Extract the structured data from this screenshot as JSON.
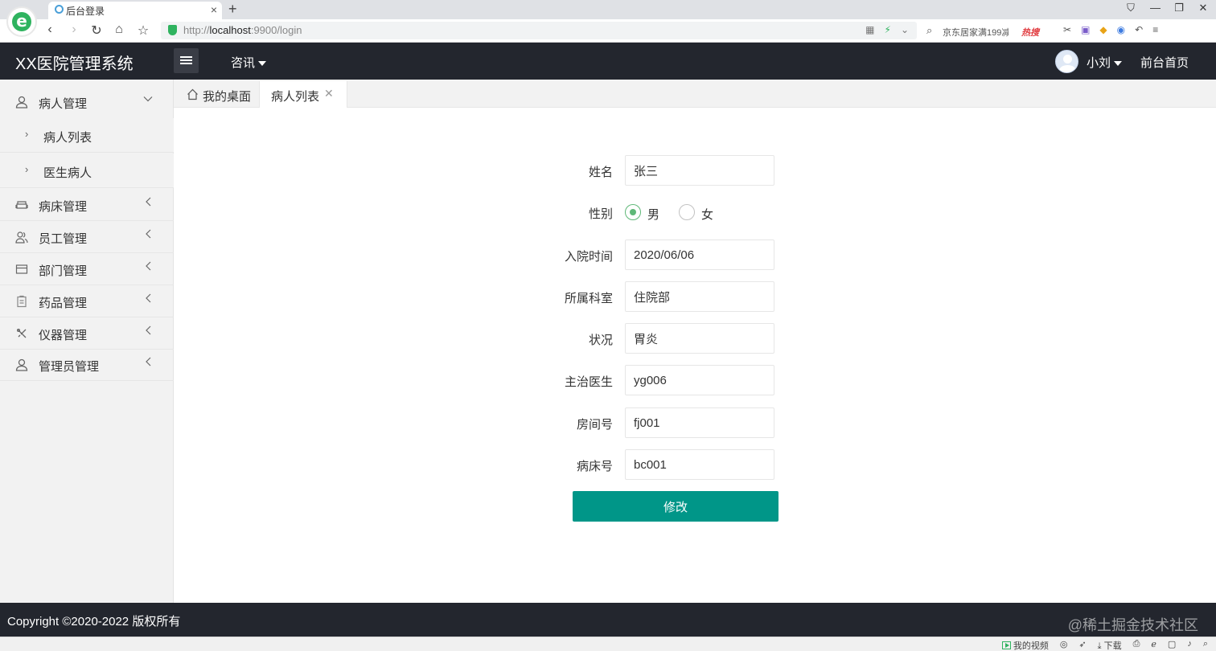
{
  "browser": {
    "tab_title": "后台登录",
    "url_prefix": "http://",
    "url_host": "localhost",
    "url_rest": ":9900/login",
    "search_text": "京东居家满199减",
    "hot_label": "热搜",
    "win_controls": [
      "⛉",
      "—",
      "❐",
      "✕"
    ],
    "status_video": "我的视频",
    "status_download": "下载"
  },
  "header": {
    "logo": "XX医院管理系统",
    "news_label": "咨讯",
    "user_name": "小刘",
    "front_home": "前台首页"
  },
  "sidebar": {
    "items": [
      {
        "label": "病人管理",
        "icon": "user-icon",
        "expanded": true
      },
      {
        "label": "病床管理",
        "icon": "sofa-icon"
      },
      {
        "label": "员工管理",
        "icon": "users-icon"
      },
      {
        "label": "部门管理",
        "icon": "card-icon"
      },
      {
        "label": "药品管理",
        "icon": "clipboard-icon"
      },
      {
        "label": "仪器管理",
        "icon": "tools-icon"
      },
      {
        "label": "管理员管理",
        "icon": "admin-icon"
      }
    ],
    "sub_items": [
      {
        "label": "病人列表"
      },
      {
        "label": "医生病人"
      }
    ]
  },
  "tabs": {
    "home": "我的桌面",
    "active": "病人列表"
  },
  "form": {
    "name_label": "姓名",
    "name_value": "张三",
    "gender_label": "性别",
    "gender_options": [
      "男",
      "女"
    ],
    "gender_selected": "男",
    "admit_label": "入院时间",
    "admit_value": "2020/06/06",
    "dept_label": "所属科室",
    "dept_value": "住院部",
    "status_label": "状况",
    "status_value": "胃炎",
    "doctor_label": "主治医生",
    "doctor_value": "yg006",
    "room_label": "房间号",
    "room_value": "fj001",
    "bed_label": "病床号",
    "bed_value": "bc001",
    "submit_label": "修改"
  },
  "footer": {
    "copyright": "Copyright ©2020-2022 版权所有",
    "watermark": "@稀土掘金技术社区"
  },
  "colors": {
    "header_bg": "#23262e",
    "primary_button": "#009688",
    "radio_checked": "#5fb878"
  }
}
